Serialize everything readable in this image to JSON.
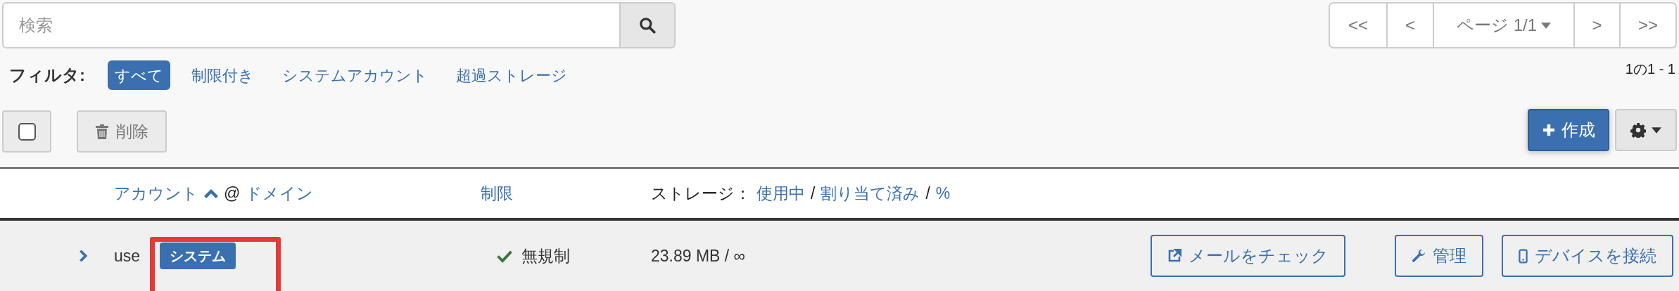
{
  "search": {
    "placeholder": "検索"
  },
  "filter": {
    "label": "フィルタ:",
    "options": [
      {
        "label": "すべて",
        "selected": true
      },
      {
        "label": "制限付き",
        "selected": false
      },
      {
        "label": "システムアカウント",
        "selected": false
      },
      {
        "label": "超過ストレージ",
        "selected": false
      }
    ]
  },
  "pagination": {
    "first": "<<",
    "prev": "<",
    "page": "ページ 1/1",
    "next": ">",
    "last": ">>",
    "count": "1の1 - 1"
  },
  "toolbar": {
    "select_all": {
      "checked": false
    },
    "delete": "削除",
    "create": "作成"
  },
  "table": {
    "columns": [
      {
        "parts": [
          {
            "kind": "link",
            "text": "アカウント"
          },
          {
            "kind": "sort"
          },
          {
            "kind": "text",
            "text": "@"
          },
          {
            "kind": "link",
            "text": "ドメイン"
          }
        ]
      },
      {
        "parts": [
          {
            "kind": "link",
            "text": "制限"
          }
        ]
      },
      {
        "parts": [
          {
            "kind": "text",
            "text": "ストレージ："
          },
          {
            "kind": "link",
            "text": "使用中"
          },
          {
            "kind": "text",
            "text": "/"
          },
          {
            "kind": "link",
            "text": "割り当て済み"
          },
          {
            "kind": "text",
            "text": "/"
          },
          {
            "kind": "link",
            "text": "%"
          }
        ]
      }
    ],
    "rows": [
      {
        "expanded": false,
        "account": "use",
        "badge": "システム",
        "highlighted": true,
        "limit": "無規制",
        "storage": "23.89 MB / ∞",
        "actions": [
          {
            "kind": "external",
            "label": "メールをチェック"
          },
          {
            "kind": "wrench",
            "label": "管理"
          },
          {
            "kind": "phone",
            "label": "デバイスを接続"
          }
        ]
      }
    ]
  }
}
